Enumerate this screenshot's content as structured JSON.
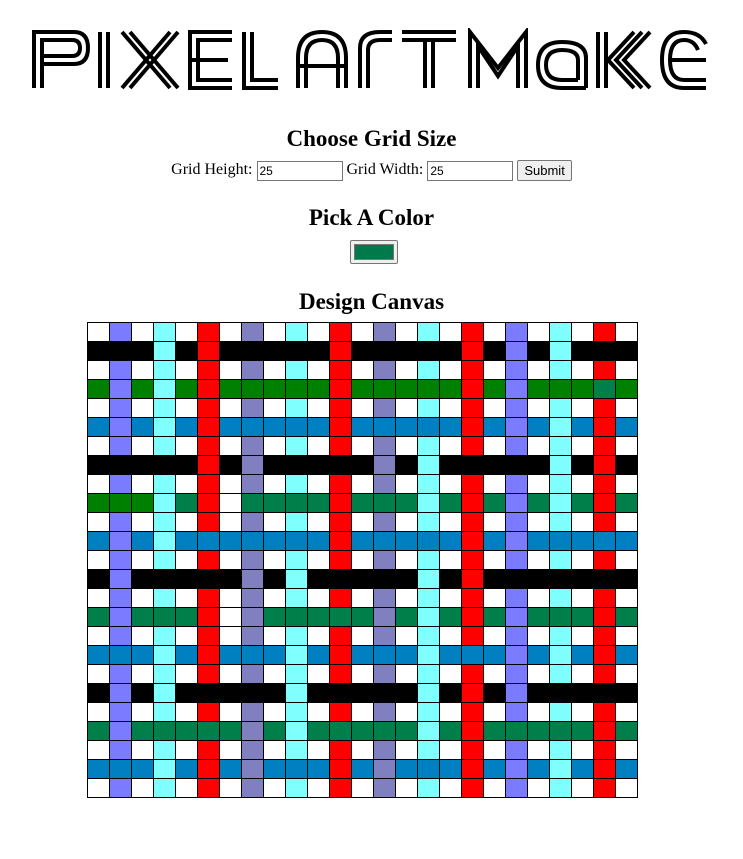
{
  "logo": {
    "text": "Pixel Art Maker"
  },
  "grid_size": {
    "heading": "Choose Grid Size",
    "height_label": "Grid Height:",
    "height_value": "25",
    "width_label": "Grid Width:",
    "width_value": "25",
    "submit_label": "Submit"
  },
  "color": {
    "heading": "Pick A Color",
    "value": "#007a4a"
  },
  "canvas": {
    "heading": "Design Canvas",
    "rows": 25,
    "cols": 25
  },
  "colors": {
    "K": "#000000",
    "G": "#008000",
    "E": "#007f4a",
    "B": "#0080c0",
    "L": "#7b7bff",
    "C": "#80ffff",
    "R": "#ff0000",
    "P": "#8080c0",
    "W": "#ffffff"
  },
  "pattern_rows": [
    "WLWCWRWPWCWRWPWCWRWLWCWRW",
    "KKKCKRKKKKKRKKKKKRKLKCKKK",
    "WLWCWRWPWCWRWPWCWRWLWCWRW",
    "GLGCGRGGGGGRGGGGGRGLGGGEG",
    "WLWCWRWPWCWRWPWCWRWLWCWRW",
    "BLBCBRBBBBBRBBBBBRBLBCBRB",
    "WLWCWRWPWCWRWPWCWRWLWCWRW",
    "KKKKKRKPKKKKKPKCKKKKKCKRK",
    "WLWCWRWPWCWRWPWCWRWLWCWRW",
    "GGGCERWEEEEREEECERELECERE",
    "WLWCWRWPWCWRWPWCWRWLWCWRW",
    "BLBCBBBBBBBRBBBBBRBLBBBBB",
    "WLWCWRWPWCWRWPWCWRWLWCWRW",
    "KLKKKKKPKCKKKKKCKRKKKKKKK",
    "WLWCWRWPWCWRWPWCWRWLWCWRW",
    "ELEEERWPEEEEEPECERELEEERE",
    "WLWCWRWPWCWRWPWCWRWLWCWRW",
    "BBBCBRBBBCBRBBBCBBBLBCBRB",
    "WLWCWRWPWCWRWPWCWRWLWCWRW",
    "KLKCKKKKKCKKKKKCKRKLKKKKK",
    "WLWCWRWPWCWRWPWCWRWLWCWRW",
    "ELEEEEEPECEEEEECEREEEEERE",
    "WLWCWRWPWCWRWPWCWRWLWCWRW",
    "BBBCBRBPBBBRBPBBBRBLBCBRB",
    "WLWCWRWPWCWRWPWCWRWLWCWRW"
  ]
}
